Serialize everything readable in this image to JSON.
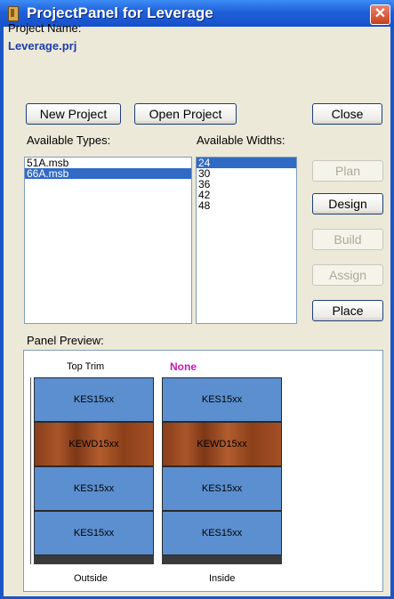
{
  "window": {
    "title": "ProjectPanel for Leverage",
    "close_glyph": "✕"
  },
  "project": {
    "name_label": "Project Name:",
    "name_value": "Leverage.prj"
  },
  "buttons": {
    "new_project": "New Project",
    "open_project": "Open Project",
    "close": "Close",
    "plan": "Plan",
    "design": "Design",
    "build": "Build",
    "assign": "Assign",
    "place": "Place"
  },
  "types": {
    "label": "Available Types:",
    "items": [
      "51A.msb",
      "66A.msb"
    ],
    "selected": "66A.msb"
  },
  "widths": {
    "label": "Available Widths:",
    "items": [
      "24",
      "30",
      "36",
      "42",
      "48"
    ],
    "selected": "24"
  },
  "preview": {
    "label": "Panel Preview:",
    "top_left_label": "Top Trim",
    "top_right_label": "None",
    "outside": {
      "label": "Outside",
      "panels": [
        "KES15xx",
        "KEWD15xx",
        "KES15xx",
        "KES15xx"
      ]
    },
    "inside": {
      "label": "Inside",
      "panels": [
        "KES15xx",
        "KEWD15xx",
        "KES15xx",
        "KES15xx"
      ]
    },
    "colors": {
      "blue_panel": "#5b8fd0",
      "wood_panel": "#9a4a22",
      "accent_none": "#c817b8"
    }
  },
  "icons": {
    "app": "app-icon",
    "close": "close-x-icon"
  }
}
